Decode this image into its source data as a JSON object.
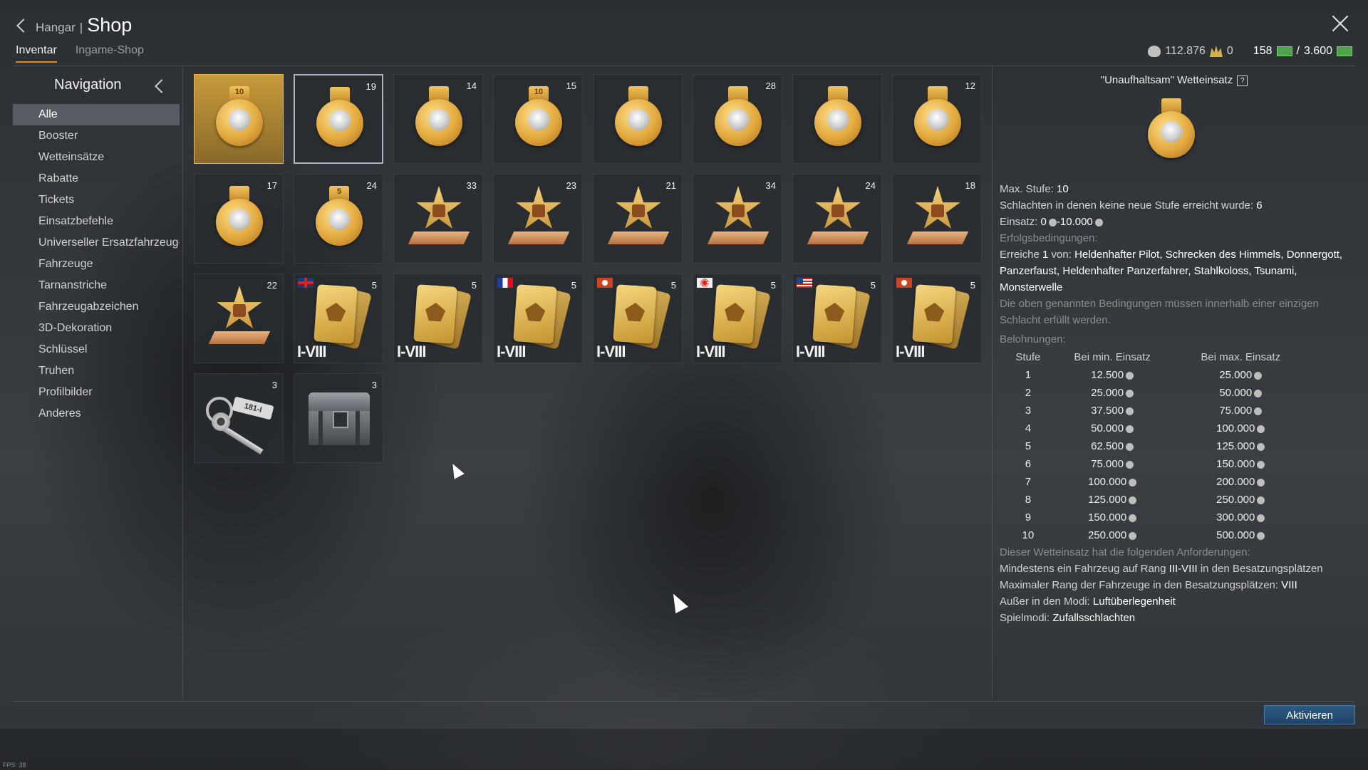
{
  "header": {
    "back_label": "Hangar",
    "separator": "|",
    "title": "Shop",
    "tabs": [
      {
        "label": "Inventar",
        "active": true
      },
      {
        "label": "Ingame-Shop",
        "active": false
      }
    ],
    "currency": {
      "silver_lions": "112.876",
      "golden_eagles": "0",
      "warbonds_current": "158",
      "warbonds_sep": "/",
      "warbonds_max": "3.600"
    }
  },
  "nav": {
    "title": "Navigation",
    "items": [
      {
        "label": "Alle",
        "active": true
      },
      {
        "label": "Booster"
      },
      {
        "label": "Wetteinsätze"
      },
      {
        "label": "Rabatte"
      },
      {
        "label": "Tickets"
      },
      {
        "label": "Einsatzbefehle"
      },
      {
        "label": "Universeller Ersatzfahrzeug-G"
      },
      {
        "label": "Fahrzeuge"
      },
      {
        "label": "Tarnanstriche"
      },
      {
        "label": "Fahrzeugabzeichen"
      },
      {
        "label": "3D-Dekoration"
      },
      {
        "label": "Schlüssel"
      },
      {
        "label": "Truhen"
      },
      {
        "label": "Profilbilder"
      },
      {
        "label": "Anderes"
      }
    ]
  },
  "inventory": {
    "tiles": [
      {
        "kind": "medal",
        "count": "",
        "ribbon": "10"
      },
      {
        "kind": "medal",
        "count": "19",
        "ribbon": ""
      },
      {
        "kind": "medal",
        "count": "14",
        "ribbon": ""
      },
      {
        "kind": "medal",
        "count": "15",
        "ribbon": "10"
      },
      {
        "kind": "medal",
        "count": "",
        "ribbon": ""
      },
      {
        "kind": "medal",
        "count": "28",
        "ribbon": ""
      },
      {
        "kind": "medal",
        "count": "",
        "ribbon": ""
      },
      {
        "kind": "medal",
        "count": "12",
        "ribbon": ""
      },
      {
        "kind": "medal",
        "count": "17",
        "ribbon": ""
      },
      {
        "kind": "medal",
        "count": "24",
        "ribbon": "5"
      },
      {
        "kind": "star",
        "count": "33"
      },
      {
        "kind": "star",
        "count": "23"
      },
      {
        "kind": "star",
        "count": "21"
      },
      {
        "kind": "star",
        "count": "34"
      },
      {
        "kind": "star",
        "count": "24"
      },
      {
        "kind": "star",
        "count": "18"
      },
      {
        "kind": "star",
        "count": "22"
      },
      {
        "kind": "card",
        "count": "5",
        "flag": "uk",
        "tier": "I-VIII"
      },
      {
        "kind": "card",
        "count": "5",
        "flag": "",
        "tier": "I-VIII"
      },
      {
        "kind": "card",
        "count": "5",
        "flag": "fr",
        "tier": "I-VIII"
      },
      {
        "kind": "card",
        "count": "5",
        "flag": "de",
        "tier": "I-VIII"
      },
      {
        "kind": "card",
        "count": "5",
        "flag": "jp",
        "tier": "I-VIII"
      },
      {
        "kind": "card",
        "count": "5",
        "flag": "us",
        "tier": "I-VIII"
      },
      {
        "kind": "card",
        "count": "5",
        "flag": "de",
        "tier": "I-VIII"
      },
      {
        "kind": "key",
        "count": "3",
        "tag": "181-I"
      },
      {
        "kind": "chest",
        "count": "3"
      }
    ]
  },
  "detail": {
    "title": "\"Unaufhaltsam\" Wetteinsatz",
    "help": "?",
    "max_level_label": "Max. Stufe:",
    "max_level_value": "10",
    "battles_label": "Schlachten in denen keine neue Stufe erreicht wurde:",
    "battles_value": "6",
    "stake_label": "Einsatz:",
    "stake_min": "0",
    "stake_max": "-10.000",
    "conditions_label": "Erfolgsbedingungen:",
    "achieve_prefix": "Erreiche",
    "achieve_count": "1",
    "achieve_mid": "von:",
    "achieve_list": "Heldenhafter Pilot, Schrecken des Himmels, Donnergott, Panzerfaust, Heldenhafter Panzerfahrer, Stahlkoloss, Tsunami, Monsterwelle",
    "single_battle_note": "Die oben genannten Bedingungen müssen innerhalb einer einzigen Schlacht erfüllt werden.",
    "rewards_label": "Belohnungen:",
    "reward_columns": [
      "Stufe",
      "Bei min. Einsatz",
      "Bei max. Einsatz"
    ],
    "rewards": [
      [
        "1",
        "12.500",
        "25.000"
      ],
      [
        "2",
        "25.000",
        "50.000"
      ],
      [
        "3",
        "37.500",
        "75.000"
      ],
      [
        "4",
        "50.000",
        "100.000"
      ],
      [
        "5",
        "62.500",
        "125.000"
      ],
      [
        "6",
        "75.000",
        "150.000"
      ],
      [
        "7",
        "100.000",
        "200.000"
      ],
      [
        "8",
        "125.000",
        "250.000"
      ],
      [
        "9",
        "150.000",
        "300.000"
      ],
      [
        "10",
        "250.000",
        "500.000"
      ]
    ],
    "requirements_intro": "Dieser Wetteinsatz hat die folgenden Anforderungen:",
    "req1_label": "Mindestens ein Fahrzeug auf Rang",
    "req1_value": "III-VIII",
    "req1_suffix": "in den Besatzungsplätzen",
    "req2_label": "Maximaler Rang der Fahrzeuge in den Besatzungsplätzen:",
    "req2_value": "VIII",
    "req3_label": "Außer in den Modi:",
    "req3_value": "Luftüberlegenheit",
    "req4_label": "Spielmodi:",
    "req4_value": "Zufallsschlachten"
  },
  "actions": {
    "activate_label": "Aktivieren"
  },
  "footer": {
    "fps": "FPS: 38"
  },
  "icons": {
    "back": "chevron-left-icon",
    "close": "close-icon",
    "silver": "silver-lion-icon",
    "gold": "golden-eagle-icon",
    "warbond": "warbond-icon"
  },
  "colors": {
    "tab_accent": "#d98a2e",
    "button": "#2e5a82",
    "selected_tile": "#c79a3b"
  }
}
